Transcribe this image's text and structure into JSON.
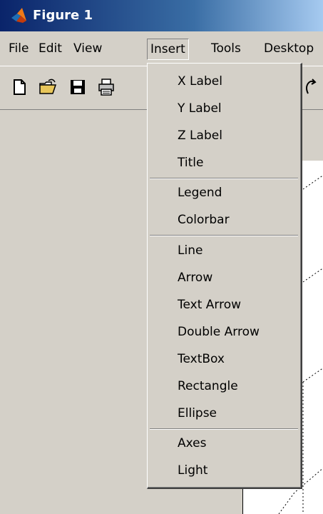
{
  "window": {
    "title": "Figure 1",
    "icon": "matlab-logo-icon"
  },
  "menubar": {
    "items": [
      {
        "label": "File"
      },
      {
        "label": "Edit"
      },
      {
        "label": "View"
      },
      {
        "label": "Insert"
      },
      {
        "label": "Tools"
      },
      {
        "label": "Desktop"
      }
    ],
    "active": "Insert"
  },
  "toolbar": {
    "icons": [
      "new-file-icon",
      "open-folder-icon",
      "save-icon",
      "print-icon",
      "rotate-icon"
    ]
  },
  "insert_menu": {
    "groups": [
      [
        "X Label",
        "Y Label",
        "Z Label",
        "Title"
      ],
      [
        "Legend",
        "Colorbar"
      ],
      [
        "Line",
        "Arrow",
        "Text Arrow",
        "Double Arrow",
        "TextBox",
        "Rectangle",
        "Ellipse"
      ],
      [
        "Axes",
        "Light"
      ]
    ],
    "items": {
      "x_label": "X Label",
      "y_label": "Y Label",
      "z_label": "Z Label",
      "title": "Title",
      "legend": "Legend",
      "colorbar": "Colorbar",
      "line": "Line",
      "arrow": "Arrow",
      "text_arrow": "Text Arrow",
      "double_arrow": "Double Arrow",
      "textbox": "TextBox",
      "rectangle": "Rectangle",
      "ellipse": "Ellipse",
      "axes": "Axes",
      "light": "Light"
    }
  },
  "colors": {
    "title_bar_start": "#0a246a",
    "title_bar_end": "#a6caf0",
    "face": "#d4d0c8",
    "axes_background": "#ffffff"
  }
}
